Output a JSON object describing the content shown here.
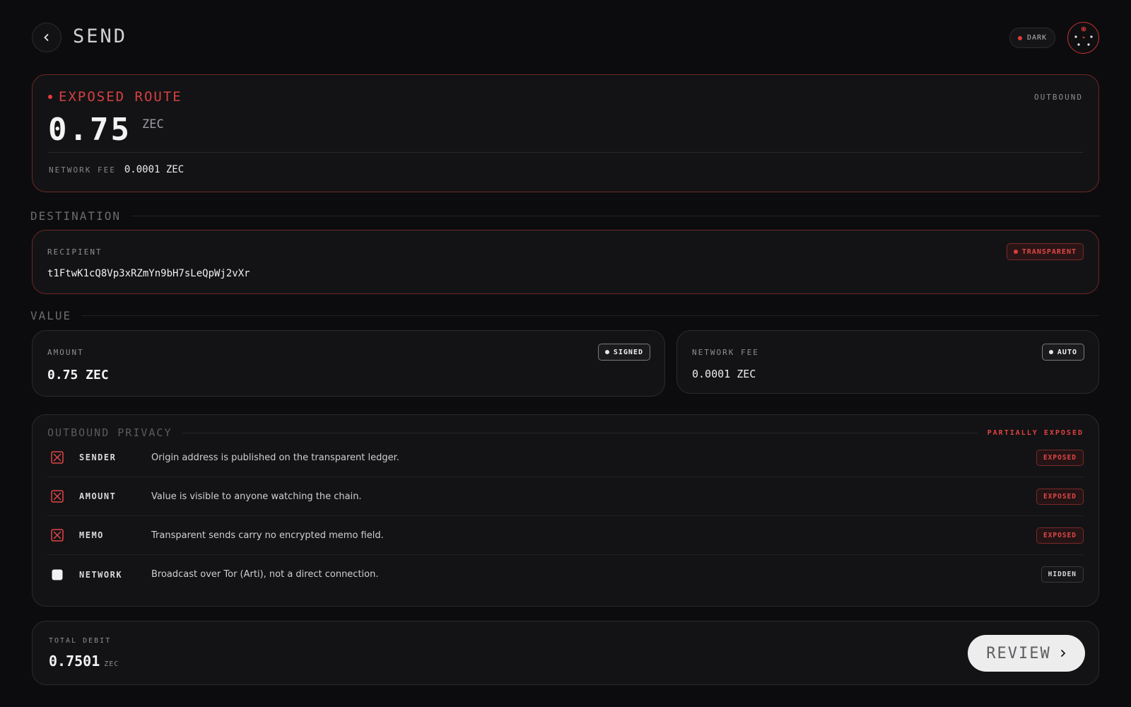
{
  "header": {
    "title": "SEND",
    "theme_label": "DARK",
    "back_icon": "chevron-left-icon",
    "avatar_icon": "avatar-icon"
  },
  "hero": {
    "route_label": "EXPOSED ROUTE",
    "direction": "OUTBOUND",
    "amount": "0.75",
    "unit": "ZEC",
    "fee_label": "NETWORK FEE",
    "fee_value": "0.0001 ZEC"
  },
  "destination": {
    "section_title": "DESTINATION",
    "label": "RECIPIENT",
    "address": "t1FtwK1cQ8Vp3xRZmYn9bH7sLeQpWj2vXr",
    "badge": "TRANSPARENT"
  },
  "value": {
    "section_title": "VALUE",
    "amount_label": "AMOUNT",
    "amount_value": "0.75 ZEC",
    "amount_badge": "SIGNED",
    "fee_label": "NETWORK FEE",
    "fee_value": "0.0001 ZEC",
    "fee_badge": "AUTO"
  },
  "privacy": {
    "title": "OUTBOUND PRIVACY",
    "status": "PARTIALLY EXPOSED",
    "rows": [
      {
        "key": "SENDER",
        "desc": "Origin address is published on the transparent ledger.",
        "badge": "EXPOSED",
        "icon": "exposed-x-icon"
      },
      {
        "key": "AMOUNT",
        "desc": "Value is visible to anyone watching the chain.",
        "badge": "EXPOSED",
        "icon": "exposed-x-icon"
      },
      {
        "key": "MEMO",
        "desc": "Transparent sends carry no encrypted memo field.",
        "badge": "EXPOSED",
        "icon": "exposed-x-icon"
      },
      {
        "key": "NETWORK",
        "desc": "Broadcast over Tor (Arti), not a direct connection.",
        "badge": "HIDDEN",
        "icon": "hidden-square-icon"
      }
    ]
  },
  "total": {
    "label": "TOTAL DEBIT",
    "value": "0.7501",
    "unit": "ZEC",
    "review_label": "REVIEW"
  },
  "colors": {
    "background": "#0c0c0e",
    "accent_red": "#e04646",
    "card": "#131315"
  }
}
